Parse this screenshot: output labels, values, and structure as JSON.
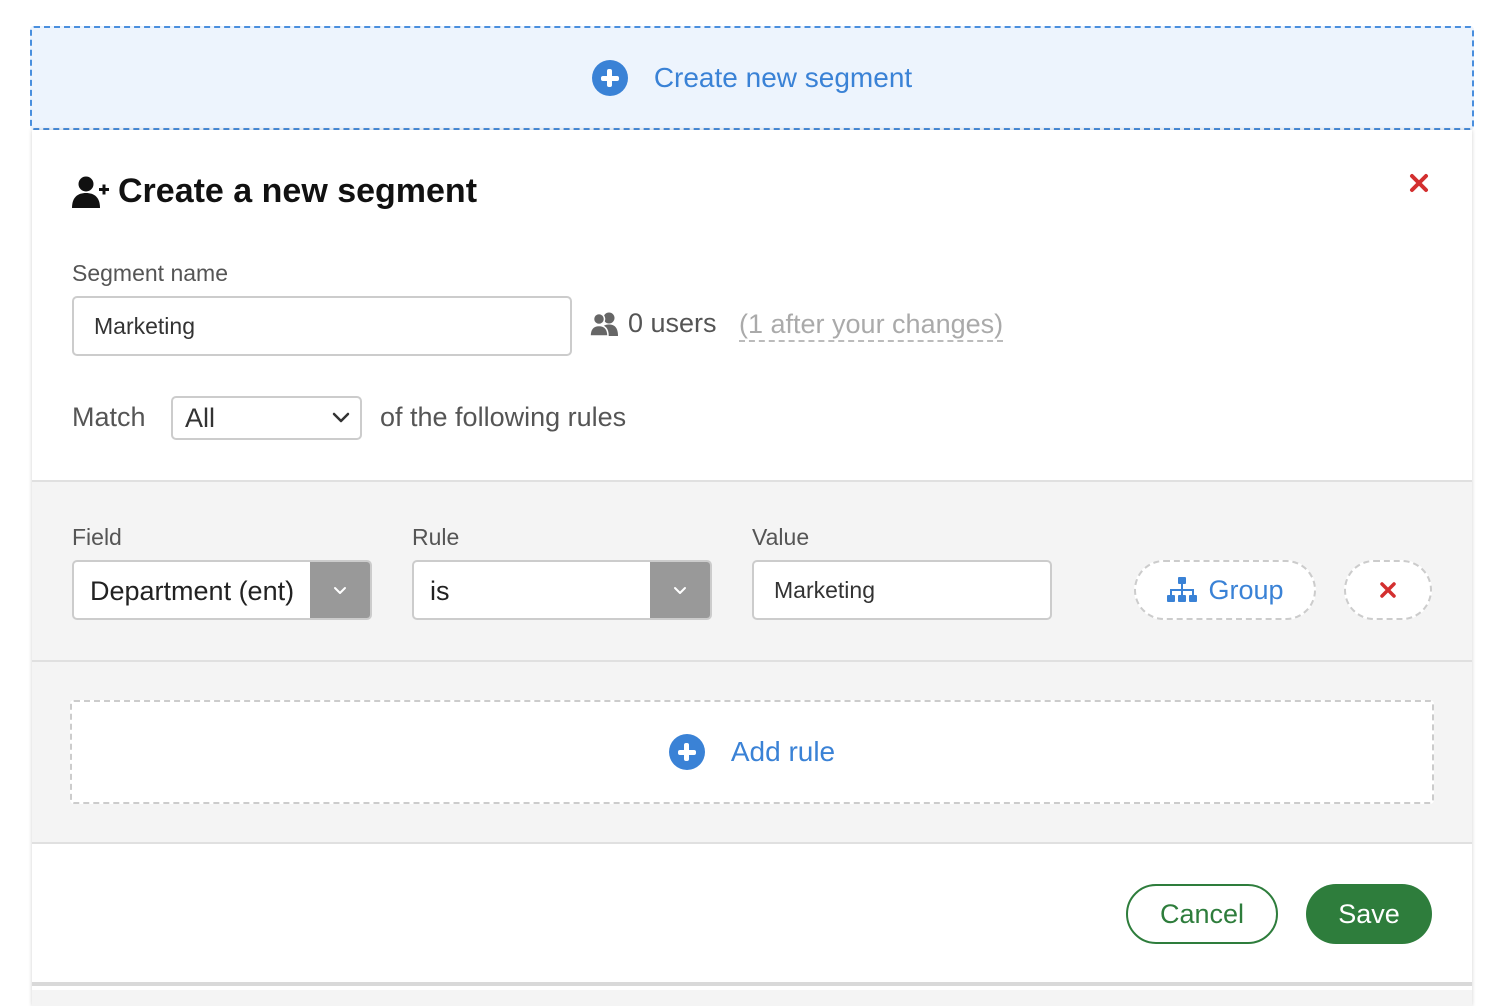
{
  "create_bar": {
    "label": "Create new segment"
  },
  "form": {
    "title": "Create a new segment",
    "segment_name_label": "Segment name",
    "segment_name_value": "Marketing",
    "users_count": "0 users",
    "after_changes": "(1 after your changes)",
    "match_label": "Match",
    "match_value": "All",
    "rules_text": "of the following rules"
  },
  "rule": {
    "field_label": "Field",
    "field_value": "Department (ent)",
    "rule_label": "Rule",
    "rule_value": "is",
    "value_label": "Value",
    "value_value": "Marketing",
    "group_label": "Group"
  },
  "add_rule": {
    "label": "Add rule"
  },
  "footer": {
    "cancel_label": "Cancel",
    "save_label": "Save"
  },
  "colors": {
    "accent_blue": "#3a82d6",
    "close_red": "#d32f2f",
    "save_green": "#2e7d3c",
    "panel_gray": "#f4f4f4"
  },
  "icons": {
    "create_bar": "plus-circle-icon",
    "title": "user-plus-icon",
    "close": "close-icon",
    "users": "users-icon",
    "match_dropdown": "chevron-down-icon",
    "group": "sitemap-icon",
    "remove_rule": "close-icon",
    "add_rule": "plus-circle-icon"
  }
}
